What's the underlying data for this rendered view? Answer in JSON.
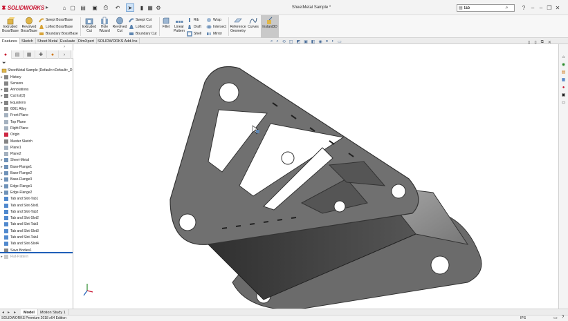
{
  "app": {
    "brand": "SOLIDWORKS",
    "document_title": "SheetMetal Sample *"
  },
  "search": {
    "value": "tab"
  },
  "command_manager": {
    "extruded_boss": "Extruded Boss/Base",
    "revolved_boss": "Revolved Boss/Base",
    "swept_boss": "Swept Boss/Base",
    "lofted_boss": "Lofted Boss/Base",
    "boundary_boss": "Boundary Boss/Base",
    "extruded_cut": "Extruded Cut",
    "hole_wizard": "Hole Wizard",
    "revolved_cut": "Revolved Cut",
    "swept_cut": "Swept Cut",
    "lofted_cut": "Lofted Cut",
    "boundary_cut": "Boundary Cut",
    "fillet": "Fillet",
    "linear_pattern": "Linear Pattern",
    "rib": "Rib",
    "draft": "Draft",
    "shell": "Shell",
    "wrap": "Wrap",
    "intersect": "Intersect",
    "mirror": "Mirror",
    "reference_geometry": "Reference Geometry",
    "curves": "Curves",
    "instant3d": "Instant3D"
  },
  "tabs": [
    "Features",
    "Sketch",
    "Sheet Metal",
    "Evaluate",
    "DimXpert",
    "SOLIDWORKS Add-Ins"
  ],
  "feature_tree": {
    "root": "SheetMetal Sample  (Default<<Default>_D",
    "items": [
      {
        "label": "History",
        "expand": true
      },
      {
        "label": "Sensors",
        "expand": false
      },
      {
        "label": "Annotations",
        "expand": true
      },
      {
        "label": "Cut list(3)",
        "expand": true
      },
      {
        "label": "Equations",
        "expand": true
      },
      {
        "label": "6061 Alloy",
        "expand": false
      },
      {
        "label": "Front Plane",
        "expand": false
      },
      {
        "label": "Top Plane",
        "expand": false
      },
      {
        "label": "Right Plane",
        "expand": false
      },
      {
        "label": "Origin",
        "expand": false
      },
      {
        "label": "Master Sketch",
        "expand": false
      },
      {
        "label": "Plane1",
        "expand": false
      },
      {
        "label": "Plane2",
        "expand": false
      },
      {
        "label": "Sheet-Metal",
        "expand": true
      },
      {
        "label": "Base-Flange1",
        "expand": true
      },
      {
        "label": "Base-Flange2",
        "expand": true
      },
      {
        "label": "Base-Flange3",
        "expand": true
      },
      {
        "label": "Edge-Flange1",
        "expand": true
      },
      {
        "label": "Edge-Flange2",
        "expand": true
      },
      {
        "label": "Tab and Slot-Tab1",
        "expand": false
      },
      {
        "label": "Tab and Slot-Slot1",
        "expand": false
      },
      {
        "label": "Tab and Slot-Tab2",
        "expand": false
      },
      {
        "label": "Tab and Slot-Slot2",
        "expand": false
      },
      {
        "label": "Tab and Slot-Tab3",
        "expand": false
      },
      {
        "label": "Tab and Slot-Slot3",
        "expand": false
      },
      {
        "label": "Tab and Slot-Tab4",
        "expand": false
      },
      {
        "label": "Tab and Slot-Slot4",
        "expand": false
      },
      {
        "label": "Save Bodies1",
        "expand": false
      },
      {
        "label": "Flat-Pattern",
        "expand": true,
        "suppressed": true
      }
    ]
  },
  "bottom_tabs": [
    "Model",
    "Motion Study 1"
  ],
  "status": {
    "edition": "SOLIDWORKS Premium 2018 x64 Edition",
    "units": "IPS"
  },
  "colors": {
    "brand_red": "#c8102e",
    "part_gray": "#6d6d6d",
    "accent_blue": "#1e5fb8"
  }
}
